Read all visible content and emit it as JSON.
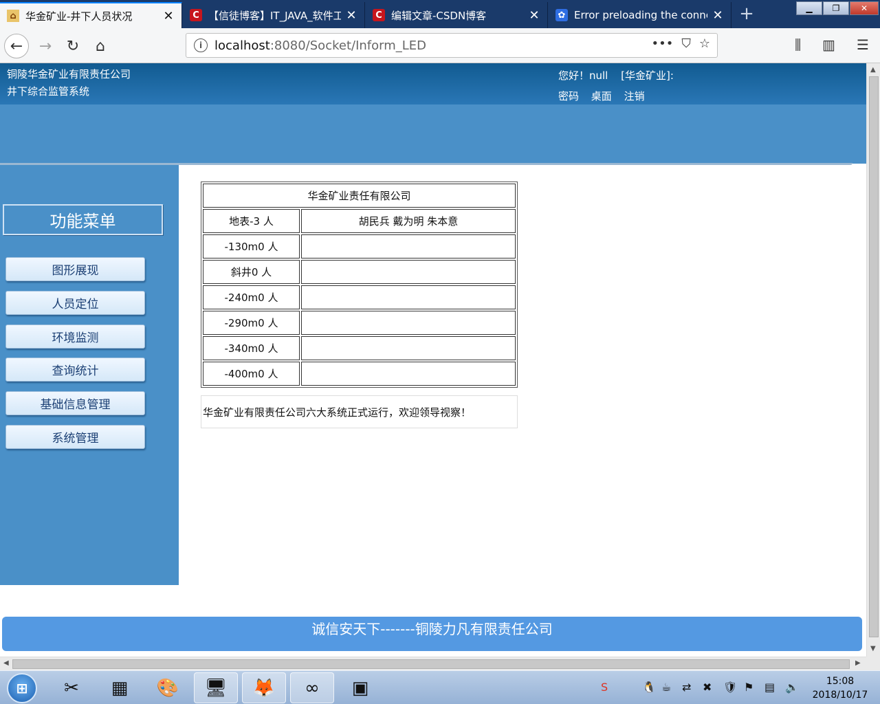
{
  "tabs": [
    {
      "title": "华金矿业-井下人员状况",
      "icon": "home-icon",
      "active": true
    },
    {
      "title": "【信徒博客】IT_JAVA_软件工",
      "icon": "csdn-icon",
      "active": false
    },
    {
      "title": "编辑文章-CSDN博客",
      "icon": "csdn-icon",
      "active": false
    },
    {
      "title": "Error preloading the conne",
      "icon": "baidu-icon",
      "active": false
    }
  ],
  "browser": {
    "url_host": "localhost",
    "url_path": ":8080/Socket/Inform_LED"
  },
  "header": {
    "company": "铜陵华金矿业有限责任公司",
    "system": "井下综合监管系统",
    "greeting": "您好！null",
    "org": "[华金矿业]:",
    "links": [
      "密码",
      "桌面",
      "注销"
    ]
  },
  "sidebar": {
    "title": "功能菜单",
    "items": [
      "图形展现",
      "人员定位",
      "环境监测",
      "查询统计",
      "基础信息管理",
      "系统管理"
    ]
  },
  "table": {
    "title": "华金矿业责任有限公司",
    "rows": [
      {
        "location": "地表-3 人",
        "people": "胡民兵 戴为明 朱本意"
      },
      {
        "location": "-130m0 人",
        "people": ""
      },
      {
        "location": "斜井0 人",
        "people": ""
      },
      {
        "location": "-240m0 人",
        "people": ""
      },
      {
        "location": "-290m0 人",
        "people": ""
      },
      {
        "location": "-340m0 人",
        "people": ""
      },
      {
        "location": "-400m0 人",
        "people": ""
      }
    ]
  },
  "notice": "华金矿业有限责任公司六大系统正式运行，欢迎领导视察！",
  "footer": "诚信安天下-------铜陵力凡有限责任公司",
  "taskbar": {
    "time": "15:08",
    "date": "2018/10/17"
  }
}
